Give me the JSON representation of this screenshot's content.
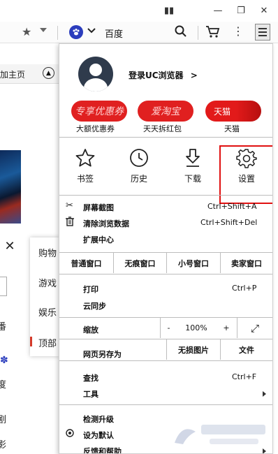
{
  "window_controls": {
    "pin": "▮▮",
    "minimize": "—",
    "restore": "❐",
    "close": "✕"
  },
  "toolbar": {
    "search_engine": "百度"
  },
  "background": {
    "bookmark_bar_label": "加主页",
    "side_chars": [
      "番",
      "度",
      "剧",
      "影"
    ],
    "popup_items": [
      "购物",
      "游戏",
      "娱乐",
      "顶部"
    ]
  },
  "menu": {
    "login_label": "登录UC浏览器",
    "login_arrow": ">",
    "promos": [
      {
        "badge": "专享优惠券",
        "caption": "大额优惠券"
      },
      {
        "badge": "爱淘宝",
        "caption": "天天拆红包"
      },
      {
        "badge": "天猫",
        "caption": "天猫"
      }
    ],
    "tools": [
      {
        "label": "书签",
        "icon": "star-icon"
      },
      {
        "label": "历史",
        "icon": "clock-icon"
      },
      {
        "label": "下载",
        "icon": "download-icon"
      },
      {
        "label": "设置",
        "icon": "gear-icon"
      }
    ],
    "screenshot": {
      "label": "屏幕截图",
      "shortcut": "Ctrl+Shift+A"
    },
    "clear_data": {
      "label": "清除浏览数据",
      "shortcut": "Ctrl+Shift+Del"
    },
    "extensions": "扩展中心",
    "windows": [
      "普通窗口",
      "无痕窗口",
      "小号窗口",
      "卖家窗口"
    ],
    "print": {
      "label": "打印",
      "shortcut": "Ctrl+P"
    },
    "cloud_sync": "云同步",
    "zoom": {
      "label": "缩放",
      "minus": "-",
      "value": "100%",
      "plus": "+",
      "fullscreen": "⤢"
    },
    "save_as": "网页另存为",
    "lossless_image": "无损图片",
    "file": "文件",
    "find": {
      "label": "查找",
      "shortcut": "Ctrl+F"
    },
    "tools_label": "工具",
    "check_update": "检测升级",
    "set_default": "设为默认",
    "feedback": "反馈和帮助"
  },
  "colors": {
    "accent_red": "#e02020",
    "highlight": "#e01010",
    "baidu_blue": "#2b3dbd"
  }
}
